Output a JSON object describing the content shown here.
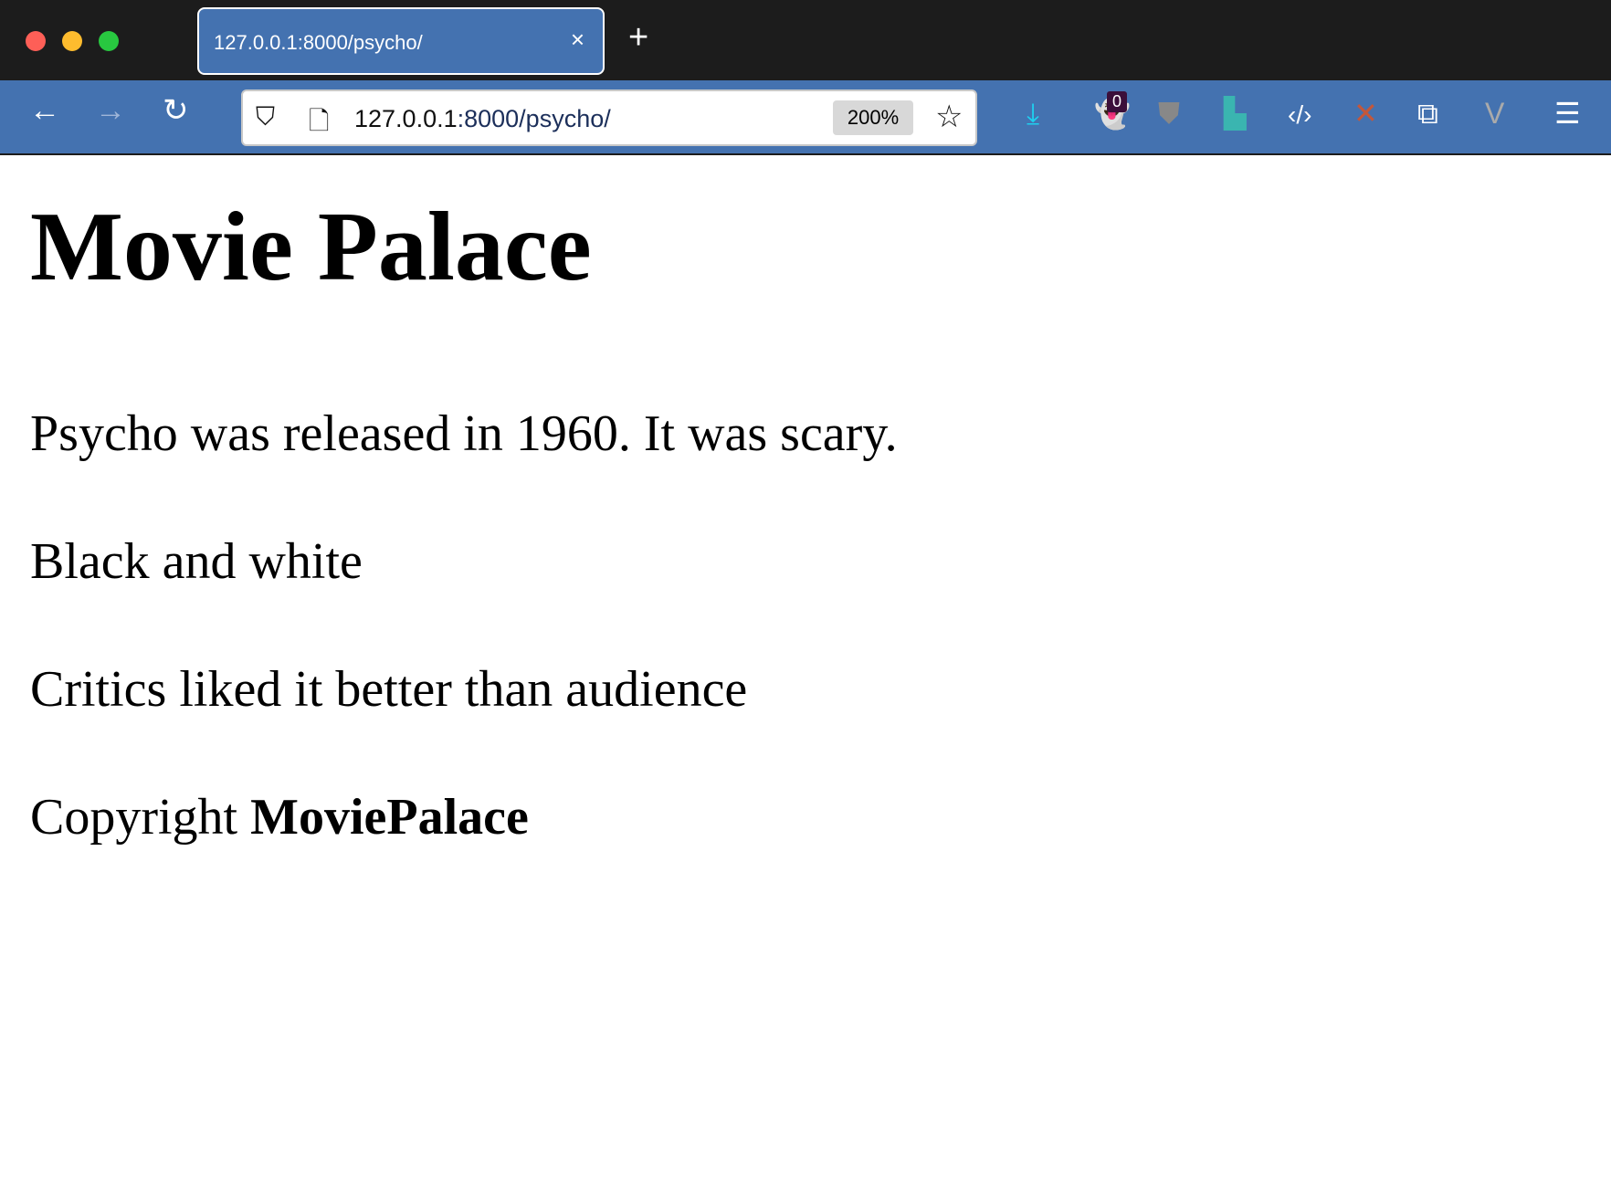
{
  "browser": {
    "tab": {
      "title": "127.0.0.1:8000/psycho/",
      "close": "×"
    },
    "new_tab": "+",
    "url": {
      "host": "127.0.0.1",
      "rest": ":8000/psycho/"
    },
    "zoom": "200%",
    "extension_badge": "0",
    "colors": {
      "toolbar": "#4472b0",
      "titlebar": "#1c1c1c"
    }
  },
  "page": {
    "title": "Movie Palace",
    "paragraphs": [
      "Psycho was released in 1960. It was scary.",
      "Black and white",
      "Critics liked it better than audience"
    ],
    "footer": {
      "prefix": "Copyright ",
      "brand": "MoviePalace"
    }
  }
}
